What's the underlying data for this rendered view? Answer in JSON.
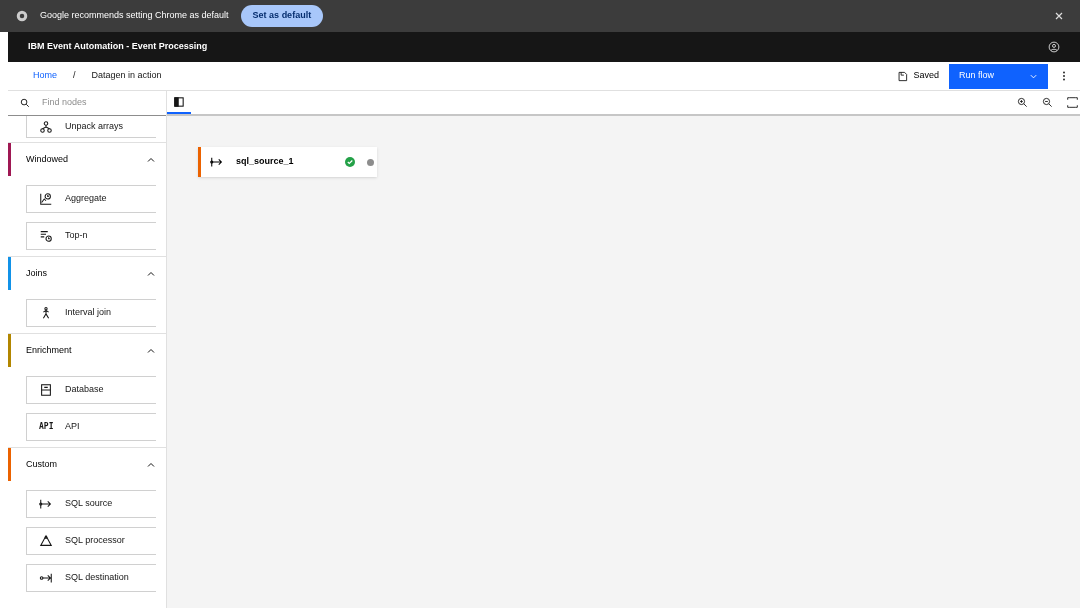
{
  "browser_bar": {
    "message": "Google recommends setting Chrome as default",
    "button": "Set as default"
  },
  "header": {
    "title": "IBM Event Automation - Event Processing"
  },
  "breadcrumb": [
    {
      "label": "Home",
      "link": true
    },
    {
      "label": "Datagen in action",
      "link": false
    }
  ],
  "breadcrumb_separator": "/",
  "toolbar": {
    "status": "Saved",
    "run_button": "Run flow"
  },
  "sidebar": {
    "search": {
      "placeholder": "Find nodes"
    },
    "top_items": [
      {
        "label": "Unpack arrays",
        "kind": "unpack"
      }
    ],
    "groups": [
      {
        "label": "Windowed",
        "color": "#9f1853",
        "expanded": true,
        "items": [
          {
            "label": "Aggregate",
            "kind": "aggregate"
          },
          {
            "label": "Top-n",
            "kind": "topn"
          }
        ]
      },
      {
        "label": "Joins",
        "color": "#1192e8",
        "expanded": true,
        "items": [
          {
            "label": "Interval join",
            "kind": "join"
          }
        ]
      },
      {
        "label": "Enrichment",
        "color": "#b28600",
        "expanded": true,
        "items": [
          {
            "label": "Database",
            "kind": "database"
          },
          {
            "label": "API",
            "kind": "api",
            "icon_text": "API"
          }
        ]
      },
      {
        "label": "Custom",
        "color": "#eb6200",
        "expanded": true,
        "items": [
          {
            "label": "SQL source",
            "kind": "source"
          },
          {
            "label": "SQL processor",
            "kind": "processor"
          },
          {
            "label": "SQL destination",
            "kind": "destination"
          }
        ]
      }
    ]
  },
  "canvas": {
    "nodes": [
      {
        "label": "sql_source_1",
        "color": "#eb6200",
        "valid": true
      }
    ]
  }
}
